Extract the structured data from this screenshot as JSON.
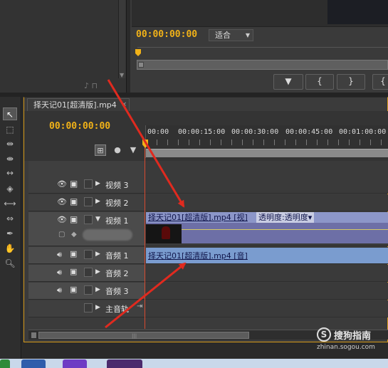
{
  "monitor": {
    "timecode": "00:00:00:00",
    "fit_select": "适合",
    "buttons": [
      "▼",
      "{",
      "}",
      "{"
    ]
  },
  "timeline": {
    "tab_title": "择天记01[超清版].mp4",
    "timecode": "00:00:00:00",
    "ruler_labels": [
      "00:00",
      "00:00:15:00",
      "00:00:30:00",
      "00:00:45:00",
      "00:01:00:00"
    ],
    "tracks": {
      "video3": "视频 3",
      "video2": "视频 2",
      "video1": "视频 1",
      "audio1": "音频 1",
      "audio2": "音频 2",
      "audio3": "音频 3",
      "master": "主音轨"
    },
    "video_clip_label": "择天记01[超清版].mp4 [视]",
    "video_clip_effect": "透明度:透明度▾",
    "audio_clip_label": "择天记01[超清版].mp4 [音]"
  },
  "watermark": {
    "logo": "S",
    "brand": "搜狗指南",
    "url": "zhinan.sogou.com"
  },
  "colors": {
    "timecode": "#f1b218",
    "arrow": "#e02a1f",
    "video_clip": "#8c96c8",
    "audio_clip": "#7a9ccf"
  }
}
